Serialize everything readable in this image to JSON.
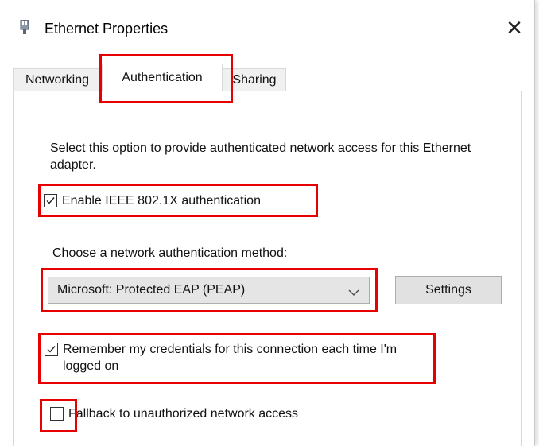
{
  "window": {
    "title": "Ethernet Properties",
    "icon": "network-adapter-icon",
    "close_glyph": "✕"
  },
  "tabs": [
    {
      "label": "Networking",
      "selected": false
    },
    {
      "label": "Authentication",
      "selected": true
    },
    {
      "label": "Sharing",
      "selected": false
    }
  ],
  "authentication": {
    "description": "Select this option to provide authenticated network access for this Ethernet adapter.",
    "enable_ieee": {
      "label": "Enable IEEE 802.1X authentication",
      "checked": true
    },
    "method_label": "Choose a network authentication method:",
    "method_select": {
      "value": "Microsoft: Protected EAP (PEAP)"
    },
    "settings_label": "Settings",
    "remember_credentials": {
      "label": "Remember my credentials for this connection each time I'm logged on",
      "checked": true
    },
    "fallback": {
      "label": "Fallback to unauthorized network access",
      "checked": false
    }
  },
  "colors": {
    "highlight": "#e60000",
    "select_bg": "#e5e5e5",
    "button_bg": "#e1e1e1"
  }
}
